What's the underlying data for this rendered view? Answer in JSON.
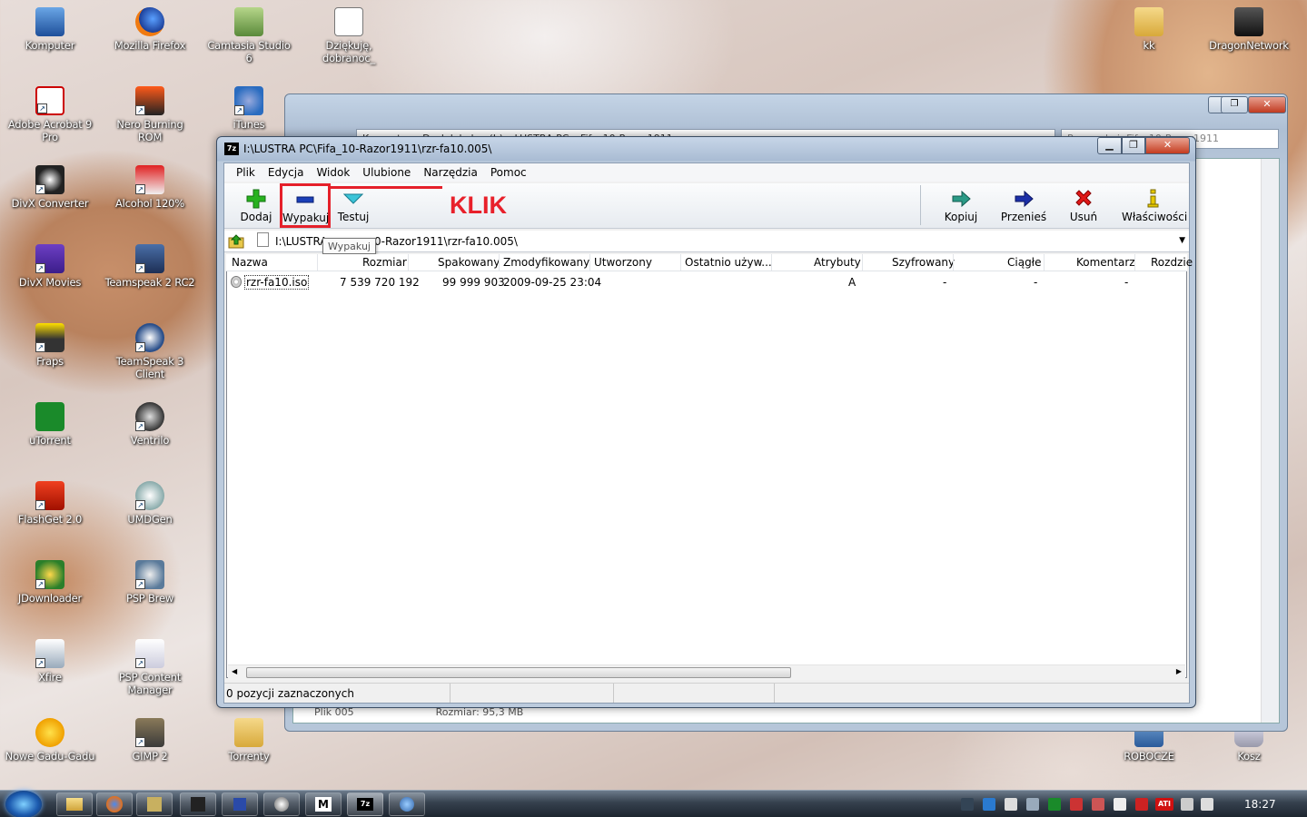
{
  "desktop": {
    "icons_col1": [
      "Komputer",
      "Adobe Acrobat 9 Pro",
      "DivX Converter",
      "DivX Movies",
      "Fraps",
      "uTorrent",
      "FlashGet 2.0",
      "JDownloader",
      "Xfire",
      "Nowe Gadu-Gadu"
    ],
    "icons_col2": [
      "Mozilla Firefox",
      "Nero Burning ROM",
      "Alcohol 120%",
      "Teamspeak 2 RC2",
      "TeamSpeak 3 Client",
      "Ventrilo",
      "UMDGen",
      "PSP Brew",
      "PSP Content Manager",
      "GIMP 2"
    ],
    "icons_col3": [
      "Camtasia Studio 6",
      "iTunes",
      "Torrenty"
    ],
    "icon_flv": "Dziękuję, dobranoc_",
    "icons_right": [
      "kk",
      "DragonNetwork",
      "ROBOCZE",
      "Kosz"
    ]
  },
  "annotation": {
    "label": "KLIK",
    "color": "#e8202a"
  },
  "window": {
    "title": "I:\\LUSTRA PC\\Fifa_10-Razor1911\\rzr-fa10.005\\",
    "logo": "7z",
    "menu": [
      "Plik",
      "Edycja",
      "Widok",
      "Ulubione",
      "Narzędzia",
      "Pomoc"
    ],
    "toolbar": {
      "add": "Dodaj",
      "extract": "Wypakuj",
      "test": "Testuj",
      "copy": "Kopiuj",
      "move": "Przenieś",
      "delete": "Usuń",
      "properties": "Właściwości"
    },
    "tooltip": "Wypakuj",
    "address_left": "I:\\LUSTRA",
    "address_right": "0-Razor1911\\rzr-fa10.005\\",
    "columns": [
      "Nazwa",
      "Rozmiar",
      "Spakowany",
      "Zmodyfikowany",
      "Utworzony",
      "Ostatnio używ...",
      "Atrybuty",
      "Szyfrowany",
      "Ciągłe",
      "Komentarz",
      "Rozdzie"
    ],
    "rows": [
      {
        "name": "rzr-fa10.iso",
        "size": "7 539 720 192",
        "packed": "99 999 903",
        "modified": "2009-09-25 23:04",
        "attr": "A",
        "encrypted": "-",
        "solid": "-",
        "comment": "-"
      }
    ],
    "status": "0 pozycji zaznaczonych"
  },
  "background_window": {
    "breadcrumb": "Komputer ▸ Dysk lokalny (I:) ▸ LUSTRA PC ▸ Fifa_10-Razor1911",
    "search_placeholder": "Przeszukaj: Fifa_10-Razor1911",
    "bottom_file": "Plik 005",
    "bottom_size": "Rozmiar: 95,3 MB"
  },
  "taskbar": {
    "clock": "18:27"
  }
}
